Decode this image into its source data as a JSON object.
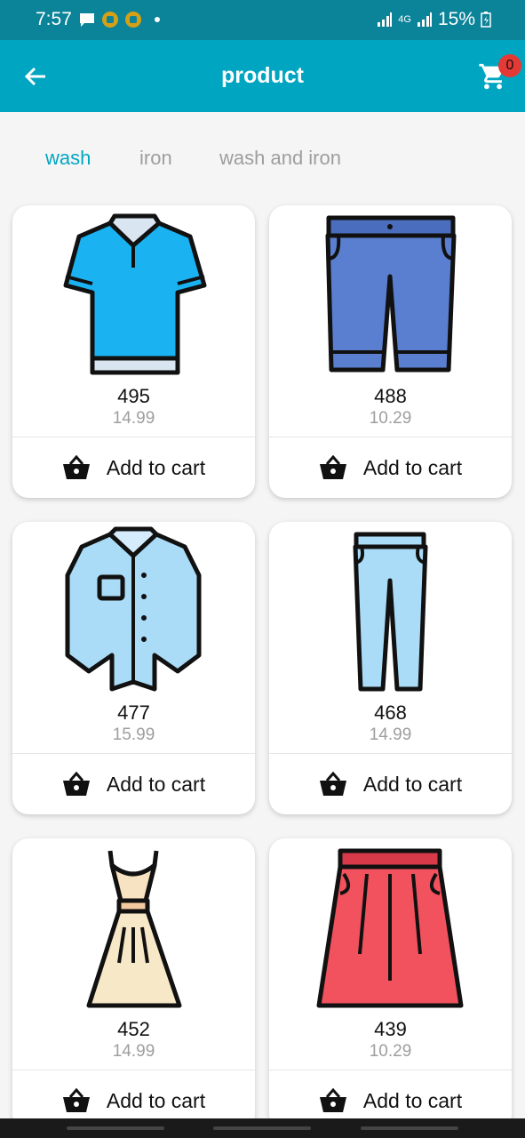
{
  "status_bar": {
    "time": "7:57",
    "network": "4G",
    "battery": "15%"
  },
  "app_bar": {
    "title": "product",
    "cart_count": "0"
  },
  "tabs": [
    {
      "label": "wash",
      "active": true
    },
    {
      "label": "iron",
      "active": false
    },
    {
      "label": "wash and iron",
      "active": false
    }
  ],
  "products": [
    {
      "name": "495",
      "price": "14.99",
      "icon": "polo-shirt-icon",
      "add_label": "Add to cart"
    },
    {
      "name": "488",
      "price": "10.29",
      "icon": "shorts-icon",
      "add_label": "Add to cart"
    },
    {
      "name": "477",
      "price": "15.99",
      "icon": "shirt-icon",
      "add_label": "Add to cart"
    },
    {
      "name": "468",
      "price": "14.99",
      "icon": "pants-icon",
      "add_label": "Add to cart"
    },
    {
      "name": "452",
      "price": "14.99",
      "icon": "dress-icon",
      "add_label": "Add to cart"
    },
    {
      "name": "439",
      "price": "10.29",
      "icon": "skirt-icon",
      "add_label": "Add to cart"
    }
  ],
  "colors": {
    "primary": "#00a6c1",
    "status_bar": "#0b8398",
    "badge": "#e53935"
  }
}
